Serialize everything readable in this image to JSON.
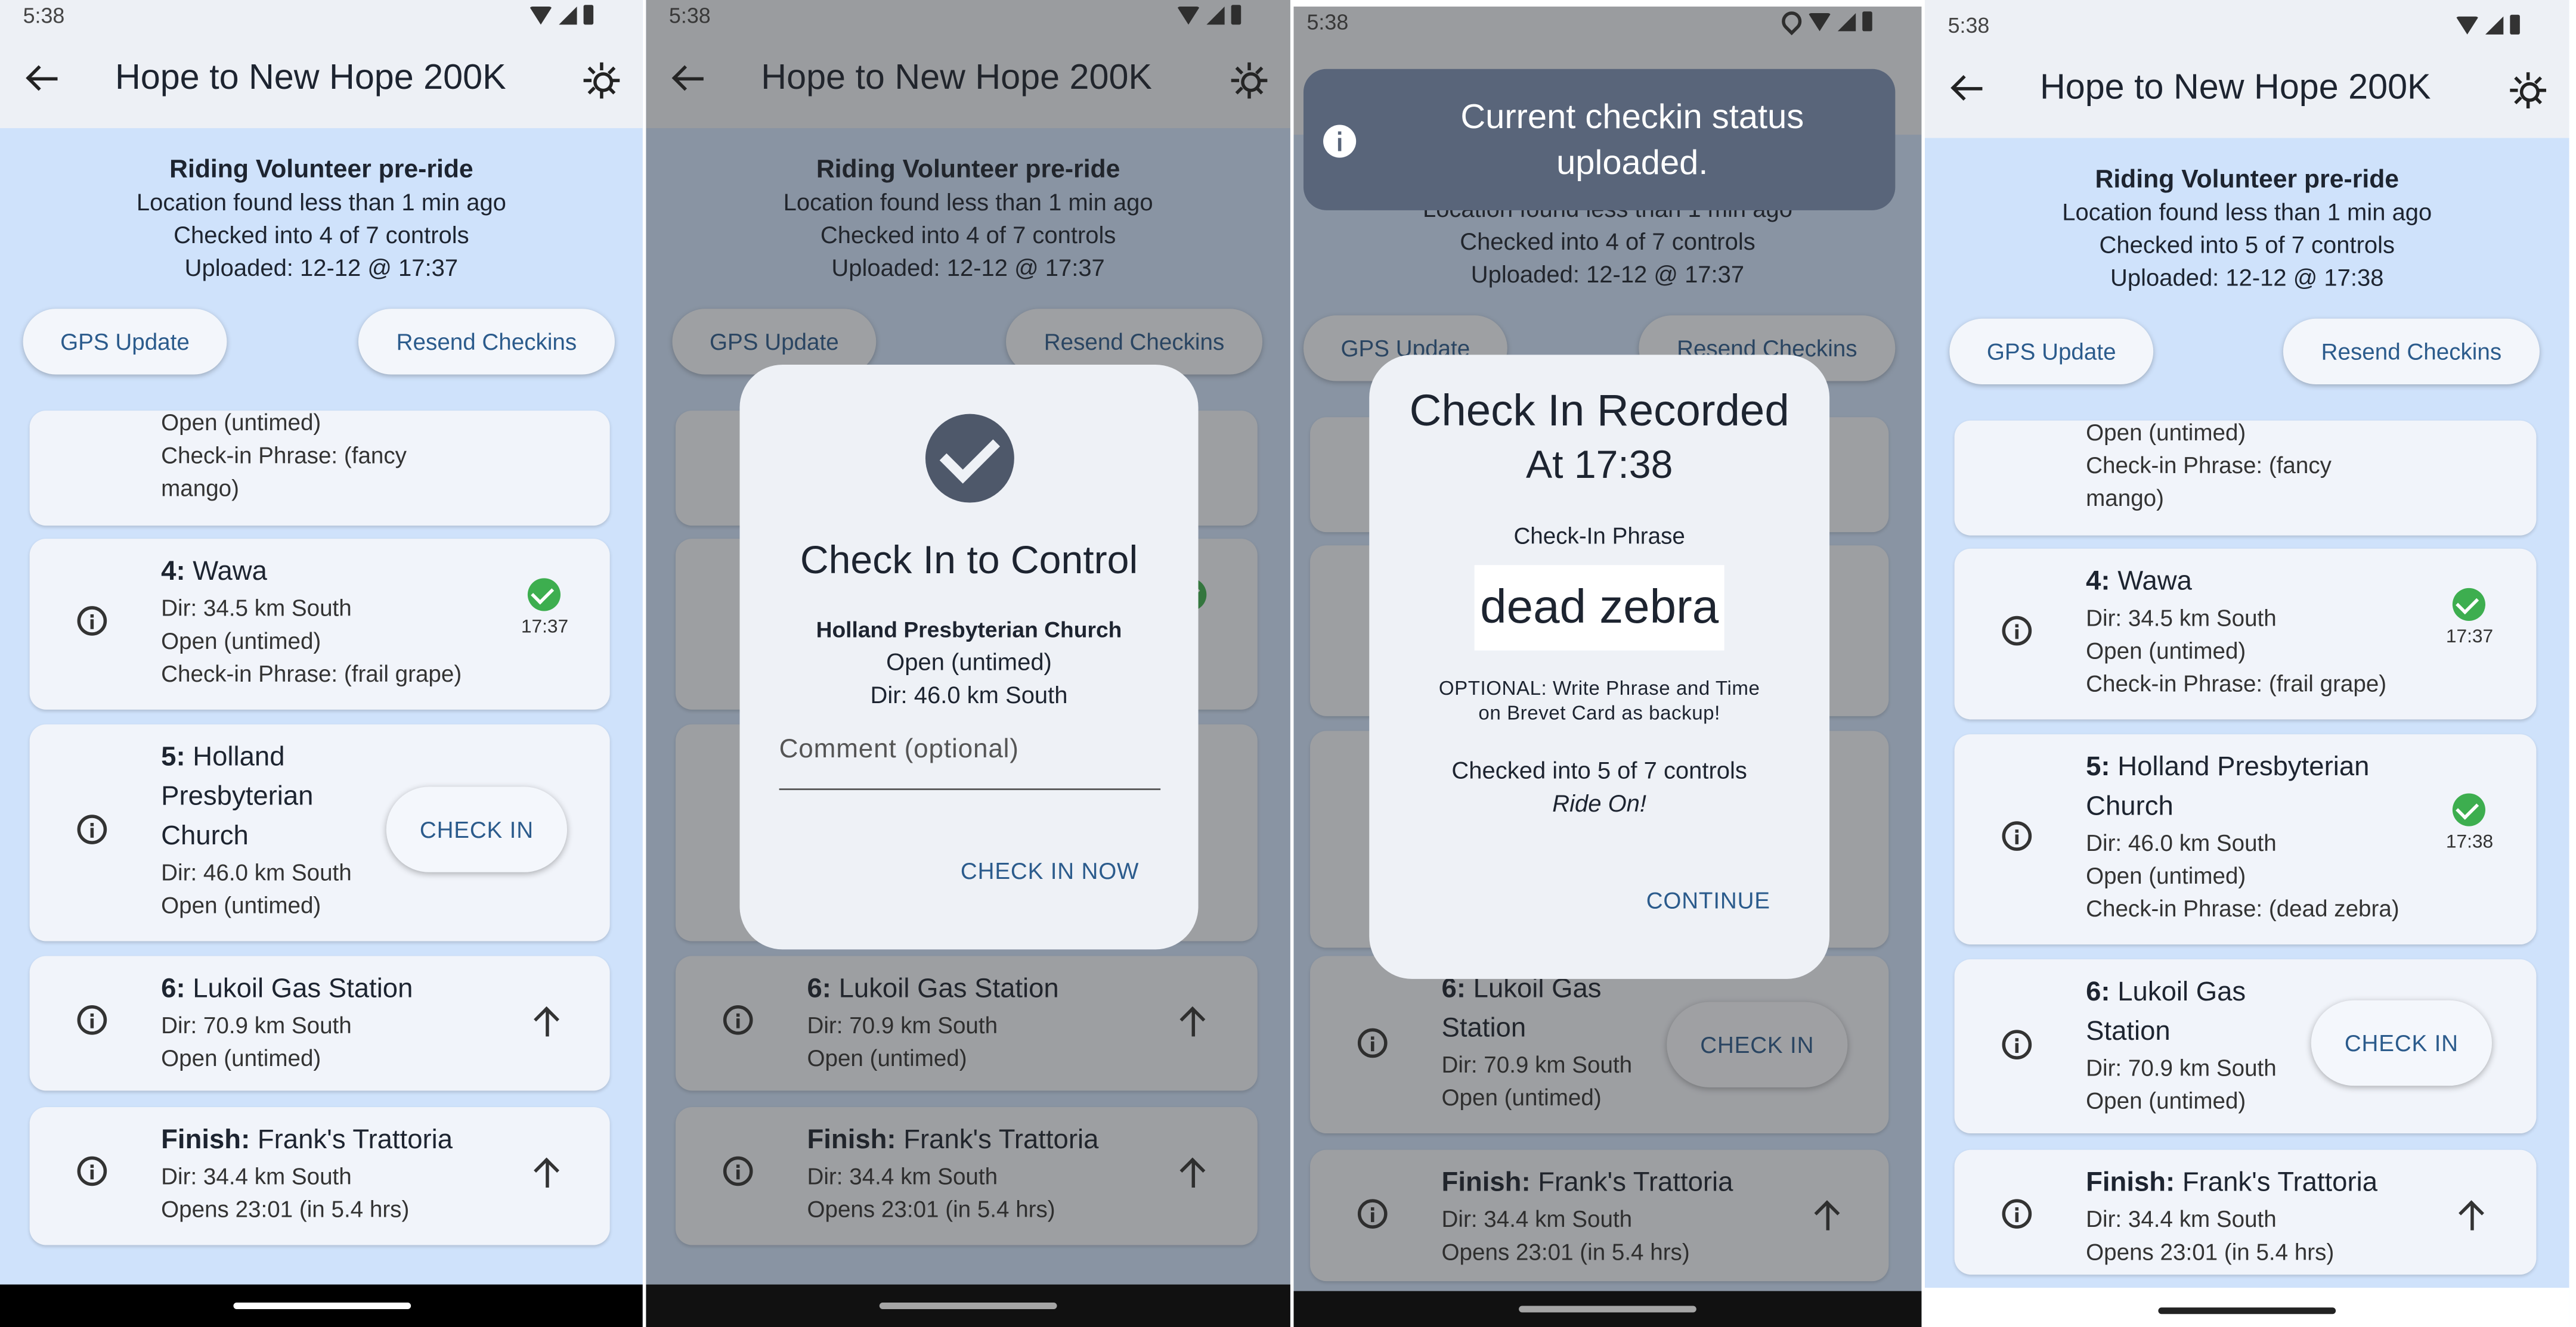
{
  "app": {
    "title": "Hope to New Hope 200K",
    "status_time": "5:38"
  },
  "summary": {
    "mode": "Riding Volunteer pre-ride",
    "location": "Location found less than 1 min  ago",
    "checked_4": "Checked into 4 of 7 controls",
    "checked_5": "Checked into 5 of 7 controls",
    "uploaded_1737": "Uploaded: 12-12 @ 17:37",
    "uploaded_1738": "Uploaded: 12-12 @ 17:38"
  },
  "buttons": {
    "gps_update": "GPS Update",
    "resend_checkins": "Resend Checkins",
    "check_in": "CHECK IN"
  },
  "controls": {
    "prev": {
      "open": "Open (untimed)",
      "phrase_line1": "Check-in Phrase: (fancy",
      "phrase_line2": "mango)"
    },
    "c4": {
      "num": "4:",
      "name": "Wawa",
      "dir": "Dir: 34.5 km South",
      "open": "Open (untimed)",
      "phrase": "Check-in Phrase: (frail grape)",
      "time": "17:37"
    },
    "c5": {
      "num": "5:",
      "name_l1": "Holland",
      "name_l2": "Presbyterian",
      "name_l3": "Church",
      "name_a": "Holland Presbyterian",
      "name_b": "Church",
      "dir": "Dir: 46.0 km South",
      "open": "Open (untimed)",
      "phrase": "Check-in Phrase: (dead zebra)",
      "time": "17:38"
    },
    "c6": {
      "num": "6:",
      "name": "Lukoil Gas Station",
      "name_a": "Lukoil Gas",
      "name_b": "Station",
      "dir": "Dir: 70.9 km South",
      "open": "Open (untimed)"
    },
    "finish": {
      "num": "Finish:",
      "name": "Frank's Trattoria",
      "dir": "Dir: 34.4 km South",
      "open": "Opens 23:01 (in 5.4 hrs)"
    }
  },
  "checkin_dialog": {
    "title": "Check In to Control",
    "control": "Holland Presbyterian Church",
    "open": "Open (untimed)",
    "dir": "Dir: 46.0 km South",
    "comment_placeholder": "Comment (optional)",
    "action": "CHECK IN NOW"
  },
  "recorded_dialog": {
    "title_l1": "Check In Recorded",
    "title_l2": "At 17:38",
    "phrase_label": "Check-In Phrase",
    "phrase": "dead zebra",
    "optional_l1": "OPTIONAL: Write Phrase and Time",
    "optional_l2": "on Brevet Card as backup!",
    "checked": "Checked into 5 of 7 controls",
    "ride_on": "Ride On!",
    "action": "CONTINUE"
  },
  "snackbar": {
    "line1": "Current checkin status",
    "line2": "uploaded."
  }
}
